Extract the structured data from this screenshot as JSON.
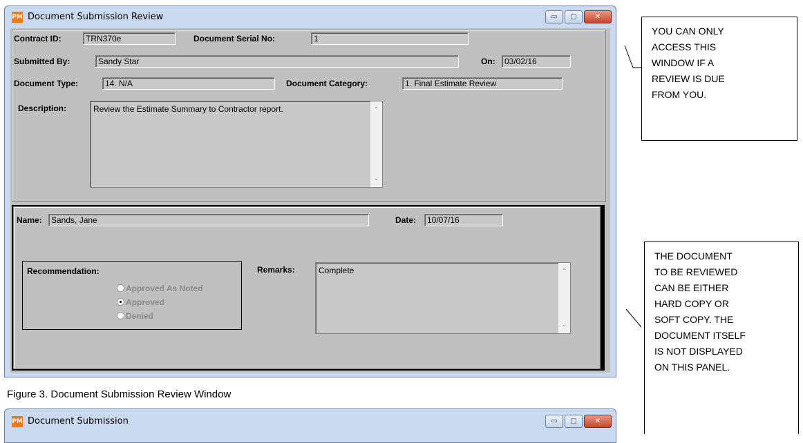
{
  "window": {
    "title": "Document Submission Review",
    "app_icon": "PM",
    "minimize_label": "▭",
    "maximize_label": "□",
    "close_label": "✕"
  },
  "header": {
    "contract_id_label": "Contract ID:",
    "contract_id_value": "TRN370e",
    "serial_no_label": "Document Serial No:",
    "serial_no_value": "1",
    "submitted_by_label": "Submitted By:",
    "submitted_by_value": "Sandy Star",
    "on_label": "On:",
    "on_value": "03/02/16",
    "doc_type_label": "Document Type:",
    "doc_type_value": "14. N/A",
    "doc_category_label": "Document Category:",
    "doc_category_value": "1. Final Estimate Review",
    "description_label": "Description:",
    "description_value": "Review the Estimate Summary to Contractor report."
  },
  "review": {
    "name_label": "Name:",
    "name_value": "Sands, Jane",
    "date_label": "Date:",
    "date_value": "10/07/16",
    "recommendation_label": "Recommendation:",
    "options": [
      "Approved As Noted",
      "Approved",
      "Denied"
    ],
    "selected_option": "Approved",
    "remarks_label": "Remarks:",
    "remarks_value": "Complete"
  },
  "caption": "Figure 3.  Document Submission Review Window",
  "second_window": {
    "title_fragment": "Document Submission"
  },
  "notes": {
    "top_lines": [
      "YOU CAN ONLY",
      "ACCESS THIS",
      "WINDOW IF A",
      "REVIEW IS DUE",
      "FROM YOU."
    ],
    "bottom_lines": [
      "THE DOCUMENT",
      "TO BE REVIEWED",
      "CAN BE EITHER",
      "HARD COPY OR",
      "SOFT COPY. THE",
      "DOCUMENT ITSELF",
      "IS NOT DISPLAYED",
      "ON THIS PANEL."
    ]
  },
  "icons": [
    "app-icon",
    "minimize-icon",
    "maximize-icon",
    "close-icon",
    "scroll-up-icon",
    "scroll-down-icon",
    "radio-icon"
  ],
  "colors": {
    "title_bar": "#c9daf0",
    "client": "#c0c0c0",
    "close_button": "#c4452c",
    "app_icon": "#f07a1a"
  }
}
